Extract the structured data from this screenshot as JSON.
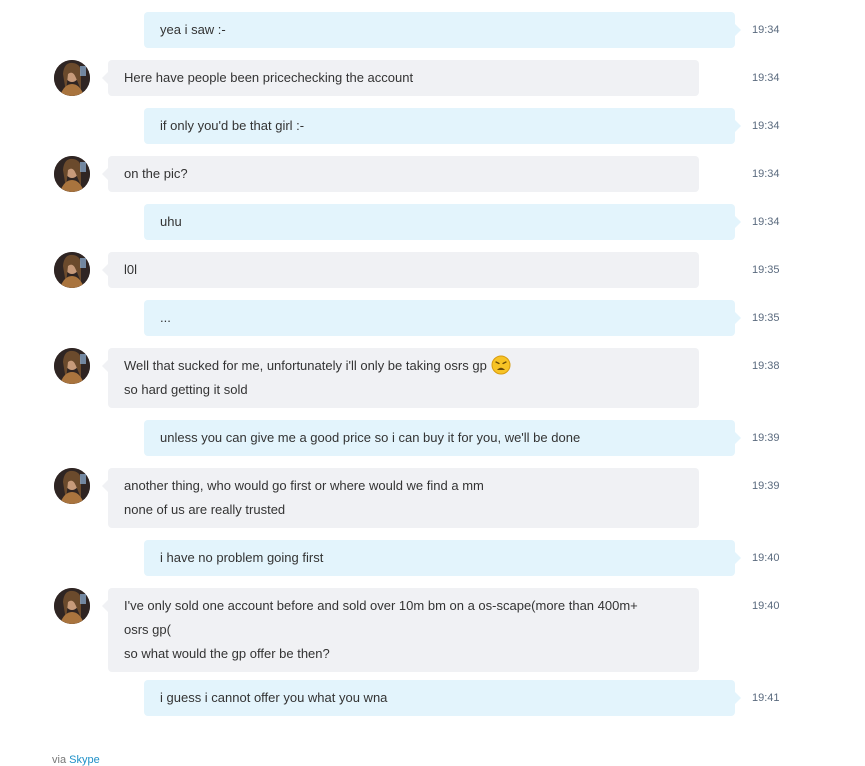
{
  "messages": [
    {
      "dir": "out",
      "lines": [
        "yea i saw :-"
      ],
      "time": "19:34"
    },
    {
      "dir": "in",
      "lines": [
        "Here have people been pricechecking the account"
      ],
      "time": "19:34"
    },
    {
      "dir": "out",
      "lines": [
        "if only you'd be that girl :-"
      ],
      "time": "19:34"
    },
    {
      "dir": "in",
      "lines": [
        "on the pic?"
      ],
      "time": "19:34"
    },
    {
      "dir": "out",
      "lines": [
        "uhu"
      ],
      "time": "19:34"
    },
    {
      "dir": "in",
      "lines": [
        "l0l"
      ],
      "time": "19:35"
    },
    {
      "dir": "out",
      "lines": [
        "..."
      ],
      "time": "19:35"
    },
    {
      "dir": "in",
      "lines": [
        "Well that sucked for me, unfortunately i'll only be taking osrs gp",
        "so hard getting it sold"
      ],
      "time": "19:38",
      "emoji": "tired-face-emoji"
    },
    {
      "dir": "out",
      "lines": [
        "unless you can give me a good price so i can buy it for you, we'll be done"
      ],
      "time": "19:39"
    },
    {
      "dir": "in",
      "lines": [
        "another thing, who would go first or where would we find a mm",
        "none of us are really trusted"
      ],
      "time": "19:39"
    },
    {
      "dir": "out",
      "lines": [
        "i have no problem going first"
      ],
      "time": "19:40"
    },
    {
      "dir": "in",
      "lines": [
        "I've only sold one account before and sold over 10m bm on a os-scape(more than 400m+",
        "osrs gp(",
        "so what would the gp offer be then?"
      ],
      "time": "19:40"
    },
    {
      "dir": "out",
      "lines": [
        "i guess i cannot offer you what you wna"
      ],
      "time": "19:41"
    }
  ],
  "footer": {
    "via": "via",
    "link": "Skype"
  },
  "colors": {
    "outgoing": "#e3f4fc",
    "incoming": "#f0f1f4",
    "timestamp": "#5a6a7e",
    "link": "#1e90c8"
  }
}
